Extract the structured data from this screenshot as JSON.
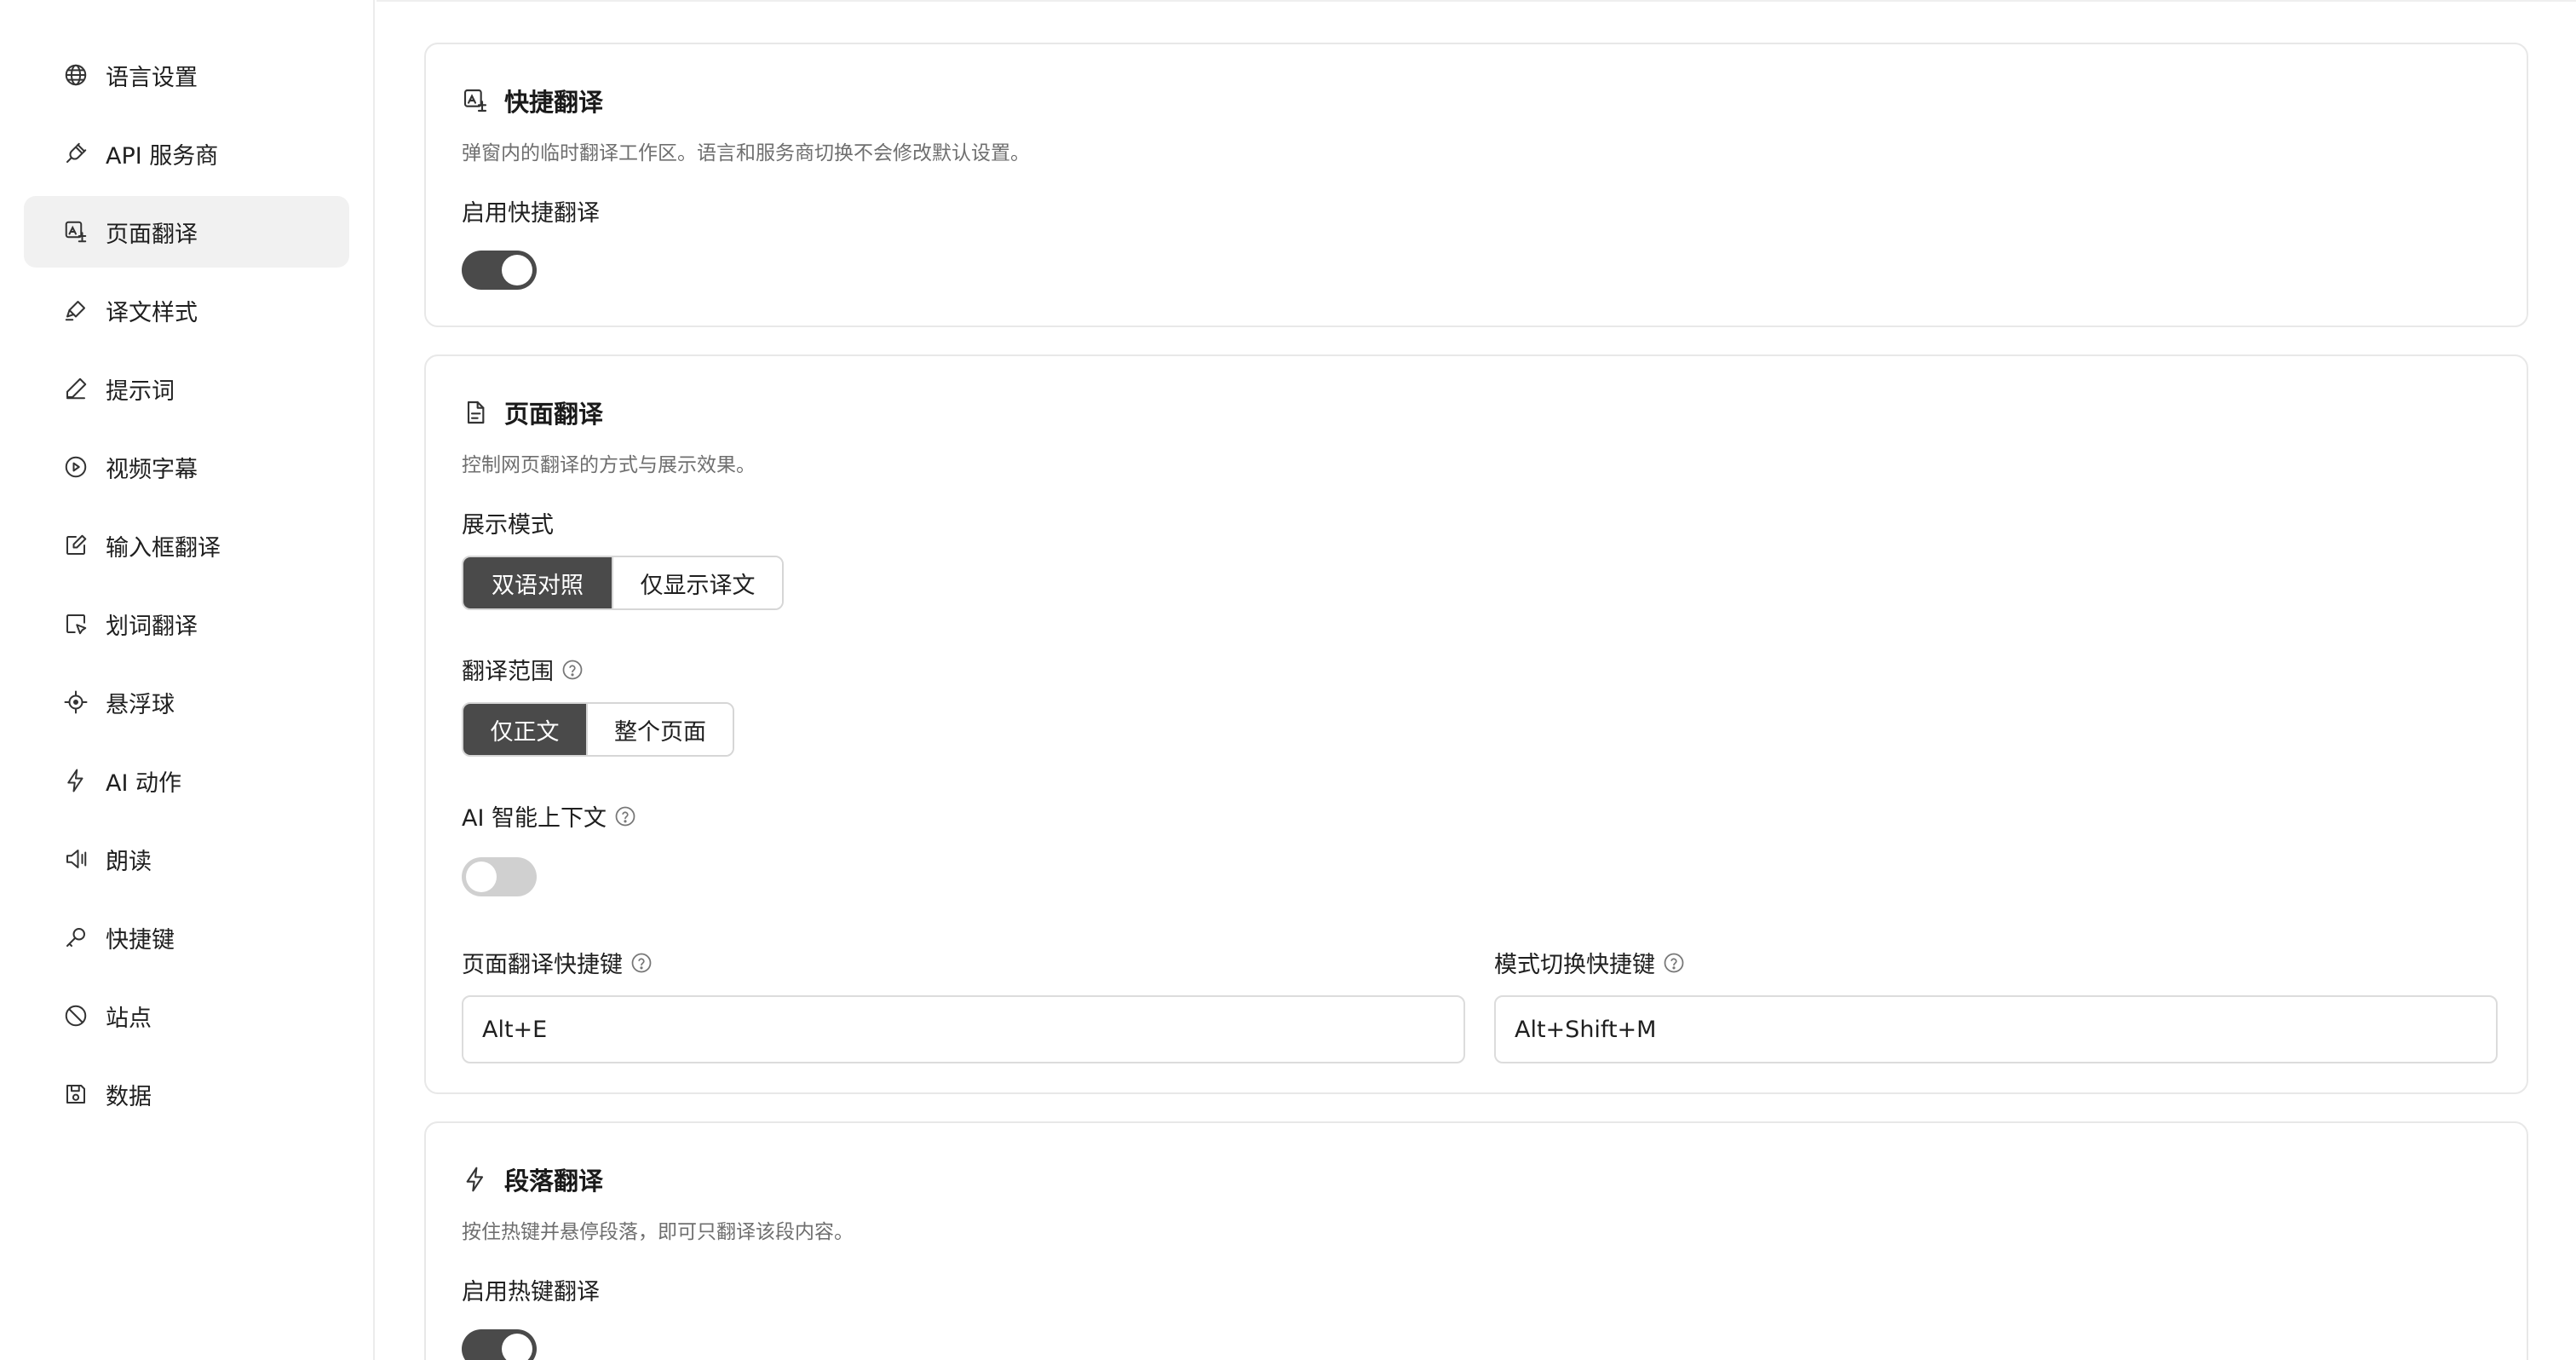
{
  "sidebar": {
    "items": [
      {
        "label": "语言设置",
        "icon": "globe-icon"
      },
      {
        "label": "API 服务商",
        "icon": "plug-icon"
      },
      {
        "label": "页面翻译",
        "icon": "page-translate-icon",
        "active": true
      },
      {
        "label": "译文样式",
        "icon": "highlighter-icon"
      },
      {
        "label": "提示词",
        "icon": "pen-icon"
      },
      {
        "label": "视频字幕",
        "icon": "play-circle-icon"
      },
      {
        "label": "输入框翻译",
        "icon": "edit-box-icon"
      },
      {
        "label": "划词翻译",
        "icon": "select-cursor-icon"
      },
      {
        "label": "悬浮球",
        "icon": "crosshair-icon"
      },
      {
        "label": "AI 动作",
        "icon": "lightning-icon"
      },
      {
        "label": "朗读",
        "icon": "speaker-icon"
      },
      {
        "label": "快捷键",
        "icon": "key-icon"
      },
      {
        "label": "站点",
        "icon": "ban-icon"
      },
      {
        "label": "数据",
        "icon": "save-icon"
      }
    ]
  },
  "quick_translate": {
    "title": "快捷翻译",
    "description": "弹窗内的临时翻译工作区。语言和服务商切换不会修改默认设置。",
    "enable_label": "启用快捷翻译",
    "enabled": true
  },
  "page_translate": {
    "title": "页面翻译",
    "description": "控制网页翻译的方式与展示效果。",
    "display_mode": {
      "label": "展示模式",
      "options": [
        "双语对照",
        "仅显示译文"
      ],
      "selected": "双语对照"
    },
    "scope": {
      "label": "翻译范围",
      "options": [
        "仅正文",
        "整个页面"
      ],
      "selected": "仅正文"
    },
    "ai_context": {
      "label": "AI 智能上下文",
      "enabled": false
    },
    "shortcut": {
      "label": "页面翻译快捷键",
      "value": "Alt+E"
    },
    "mode_shortcut": {
      "label": "模式切换快捷键",
      "value": "Alt+Shift+M"
    }
  },
  "paragraph_translate": {
    "title": "段落翻译",
    "description": "按住热键并悬停段落，即可只翻译该段内容。",
    "enable_label": "启用热键翻译",
    "enabled": true
  }
}
